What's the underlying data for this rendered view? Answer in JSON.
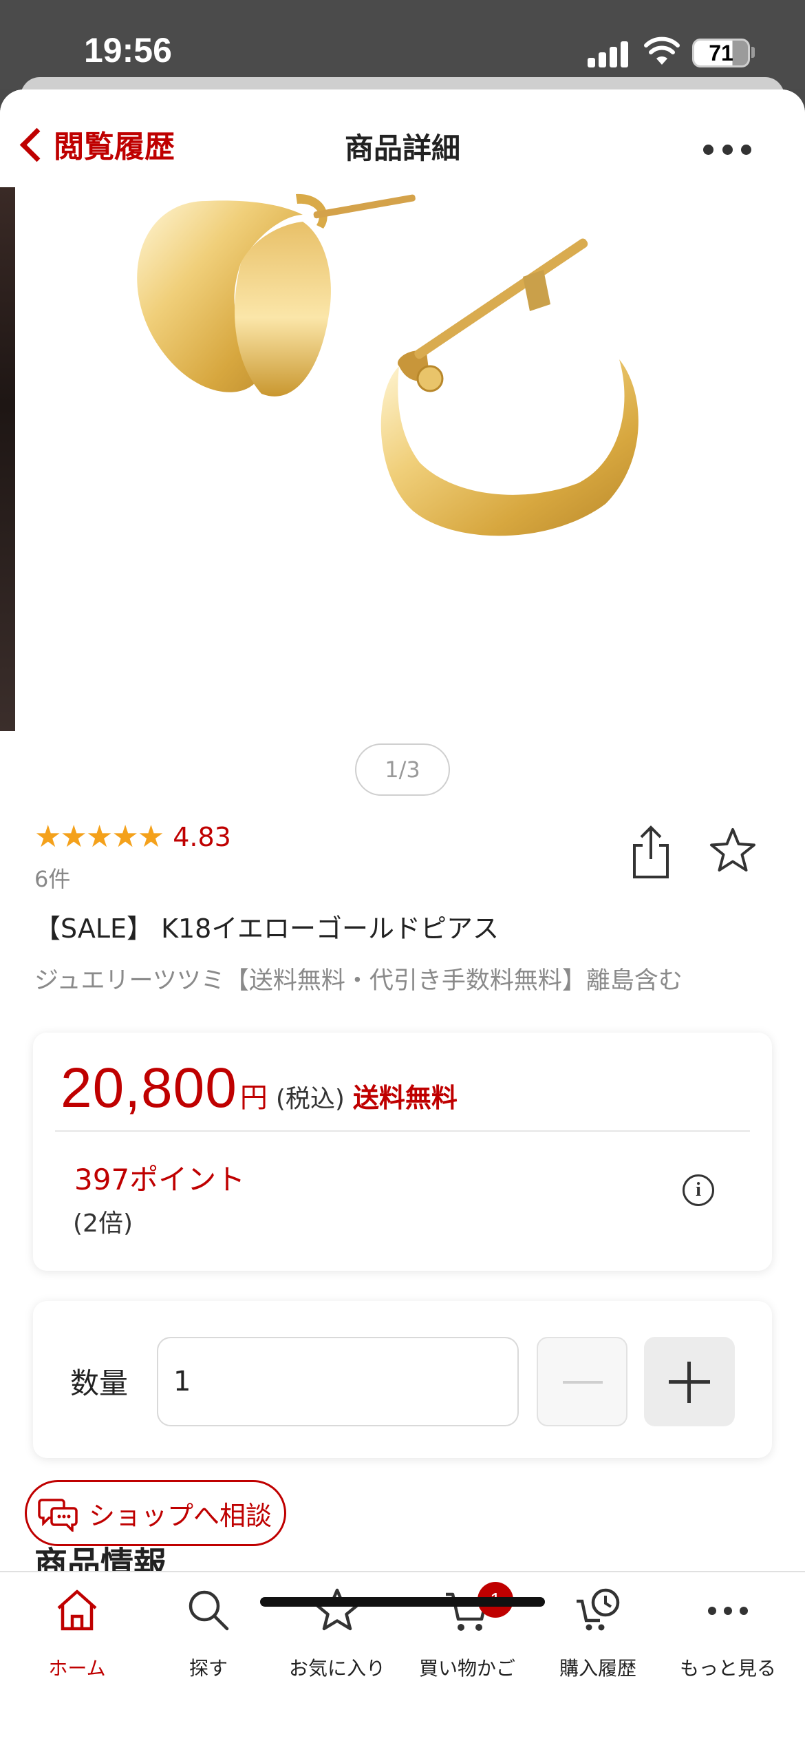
{
  "status_bar": {
    "time": "19:56",
    "battery": "71"
  },
  "header": {
    "back_label": "閲覧履歴",
    "title": "商品詳細"
  },
  "gallery": {
    "pager": "1/3"
  },
  "product": {
    "stars": "★★★★★",
    "rating": "4.83",
    "review_count": "6件",
    "title": "【SALE】 K18イエローゴールドピアス",
    "shop": "ジュエリーツツミ【送料無料・代引き手数料無料】離島含む"
  },
  "price": {
    "amount": "20,800",
    "yen": "円",
    "tax": "(税込)",
    "shipping": "送料無料",
    "points": "397ポイント",
    "multiplier": "(2倍)"
  },
  "quantity": {
    "label": "数量",
    "value": "1"
  },
  "consult": {
    "label": "ショップへ相談"
  },
  "section": {
    "title": "商品情報"
  },
  "bottom_nav": {
    "items": [
      {
        "label": "ホーム",
        "icon": "home-icon"
      },
      {
        "label": "探す",
        "icon": "search-icon"
      },
      {
        "label": "お気に入り",
        "icon": "star-icon"
      },
      {
        "label": "買い物かご",
        "icon": "cart-icon"
      },
      {
        "label": "購入履歴",
        "icon": "history-icon"
      },
      {
        "label": "もっと見る",
        "icon": "more-icon"
      }
    ],
    "cart_count": "1"
  },
  "colors": {
    "brand": "#bf0000",
    "star": "#f4a11b",
    "gold": "#e9c46a"
  }
}
